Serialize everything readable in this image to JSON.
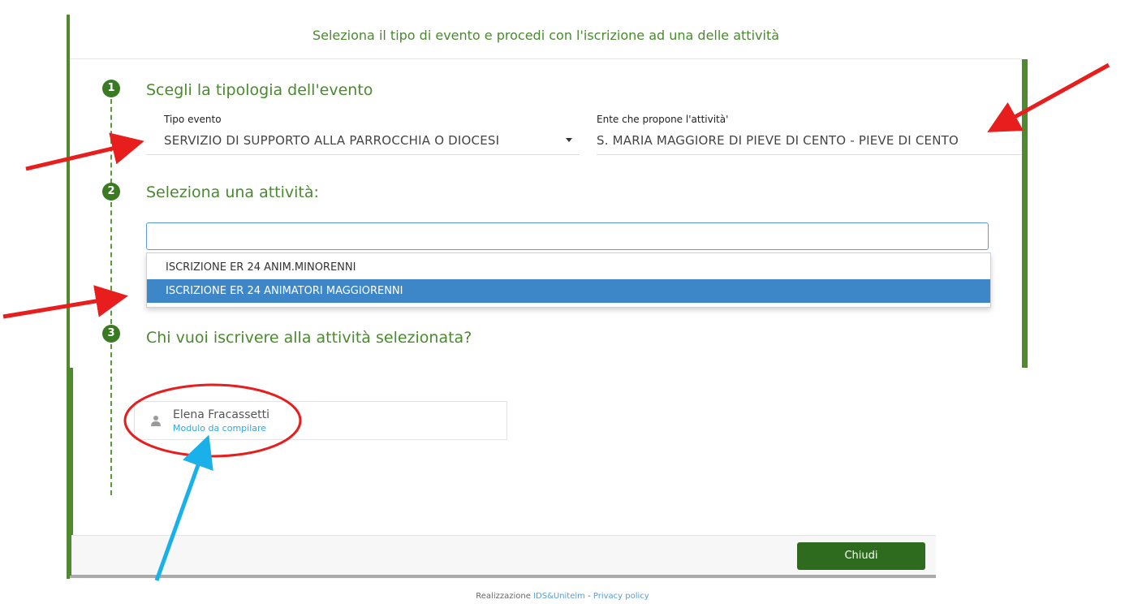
{
  "header": {
    "title": "Seleziona il tipo di evento e procedi con l'iscrizione ad una delle attività"
  },
  "steps": [
    {
      "number": "1",
      "title": "Scegli la tipologia dell'evento"
    },
    {
      "number": "2",
      "title": "Seleziona una attività:"
    },
    {
      "number": "3",
      "title": "Chi vuoi iscrivere alla attività selezionata?"
    }
  ],
  "tipo_evento": {
    "label": "Tipo evento",
    "value": "SERVIZIO DI SUPPORTO ALLA PARROCCHIA O DIOCESI"
  },
  "ente": {
    "label": "Ente che propone l'attività'",
    "value": "S. MARIA MAGGIORE DI PIEVE DI CENTO - PIEVE DI CENTO"
  },
  "activity_search": {
    "value": "",
    "placeholder": ""
  },
  "activity_options": [
    {
      "label": "ISCRIZIONE ER 24 ANIM.MINORENNI",
      "selected": false
    },
    {
      "label": "ISCRIZIONE ER 24 ANIMATORI MAGGIORENNI",
      "selected": true
    }
  ],
  "person": {
    "name": "Elena Fracassetti",
    "status": "Modulo da compilare"
  },
  "footer": {
    "close_label": "Chiudi",
    "credit_prefix": "Realizzazione",
    "credit_link": "IDS&Unitelm",
    "separator": "-",
    "privacy_link": "Privacy policy"
  },
  "colors": {
    "accent_green": "#4f8a2e",
    "button_green": "#2f6b1e",
    "selected_blue": "#3d87c8",
    "annotation_red": "#e81d1d",
    "annotation_blue": "#1ab0ea"
  }
}
